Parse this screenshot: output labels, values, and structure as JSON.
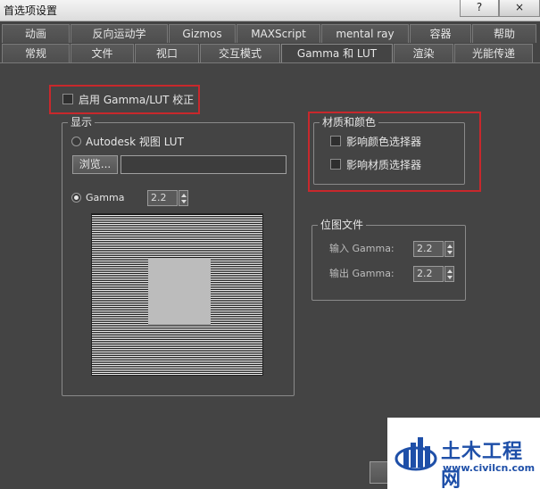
{
  "window": {
    "title": "首选项设置",
    "help_button": "?",
    "close_button": "×"
  },
  "tabs_row1": [
    "动画",
    "反向运动学",
    "Gizmos",
    "MAXScript",
    "mental ray",
    "容器",
    "帮助"
  ],
  "tabs_row2": [
    "常规",
    "文件",
    "视口",
    "交互模式",
    "Gamma 和 LUT",
    "渲染",
    "光能传递"
  ],
  "active_tab": "Gamma 和 LUT",
  "enable_gamma": {
    "label": "启用 Gamma/LUT 校正",
    "checked": false
  },
  "display": {
    "title": "显示",
    "autodesk_lut_label": "Autodesk 视图 LUT",
    "autodesk_lut_selected": false,
    "browse_label": "浏览...",
    "lut_path": "",
    "gamma_label": "Gamma",
    "gamma_selected": true,
    "gamma_value": "2.2"
  },
  "materials_colors": {
    "title": "材质和颜色",
    "affect_color_picker": {
      "label": "影响颜色选择器",
      "checked": false
    },
    "affect_material_editor": {
      "label": "影响材质选择器",
      "checked": false
    }
  },
  "bitmap_files": {
    "title": "位图文件",
    "input_gamma_label": "输入 Gamma:",
    "input_gamma_value": "2.2",
    "output_gamma_label": "输出 Gamma:",
    "output_gamma_value": "2.2"
  },
  "watermark": {
    "title": "土木工程网",
    "url": "www.civilcn.com"
  },
  "colors": {
    "background": "#444444",
    "highlight": "#c8282c",
    "watermark_blue": "#1e4fa8"
  }
}
